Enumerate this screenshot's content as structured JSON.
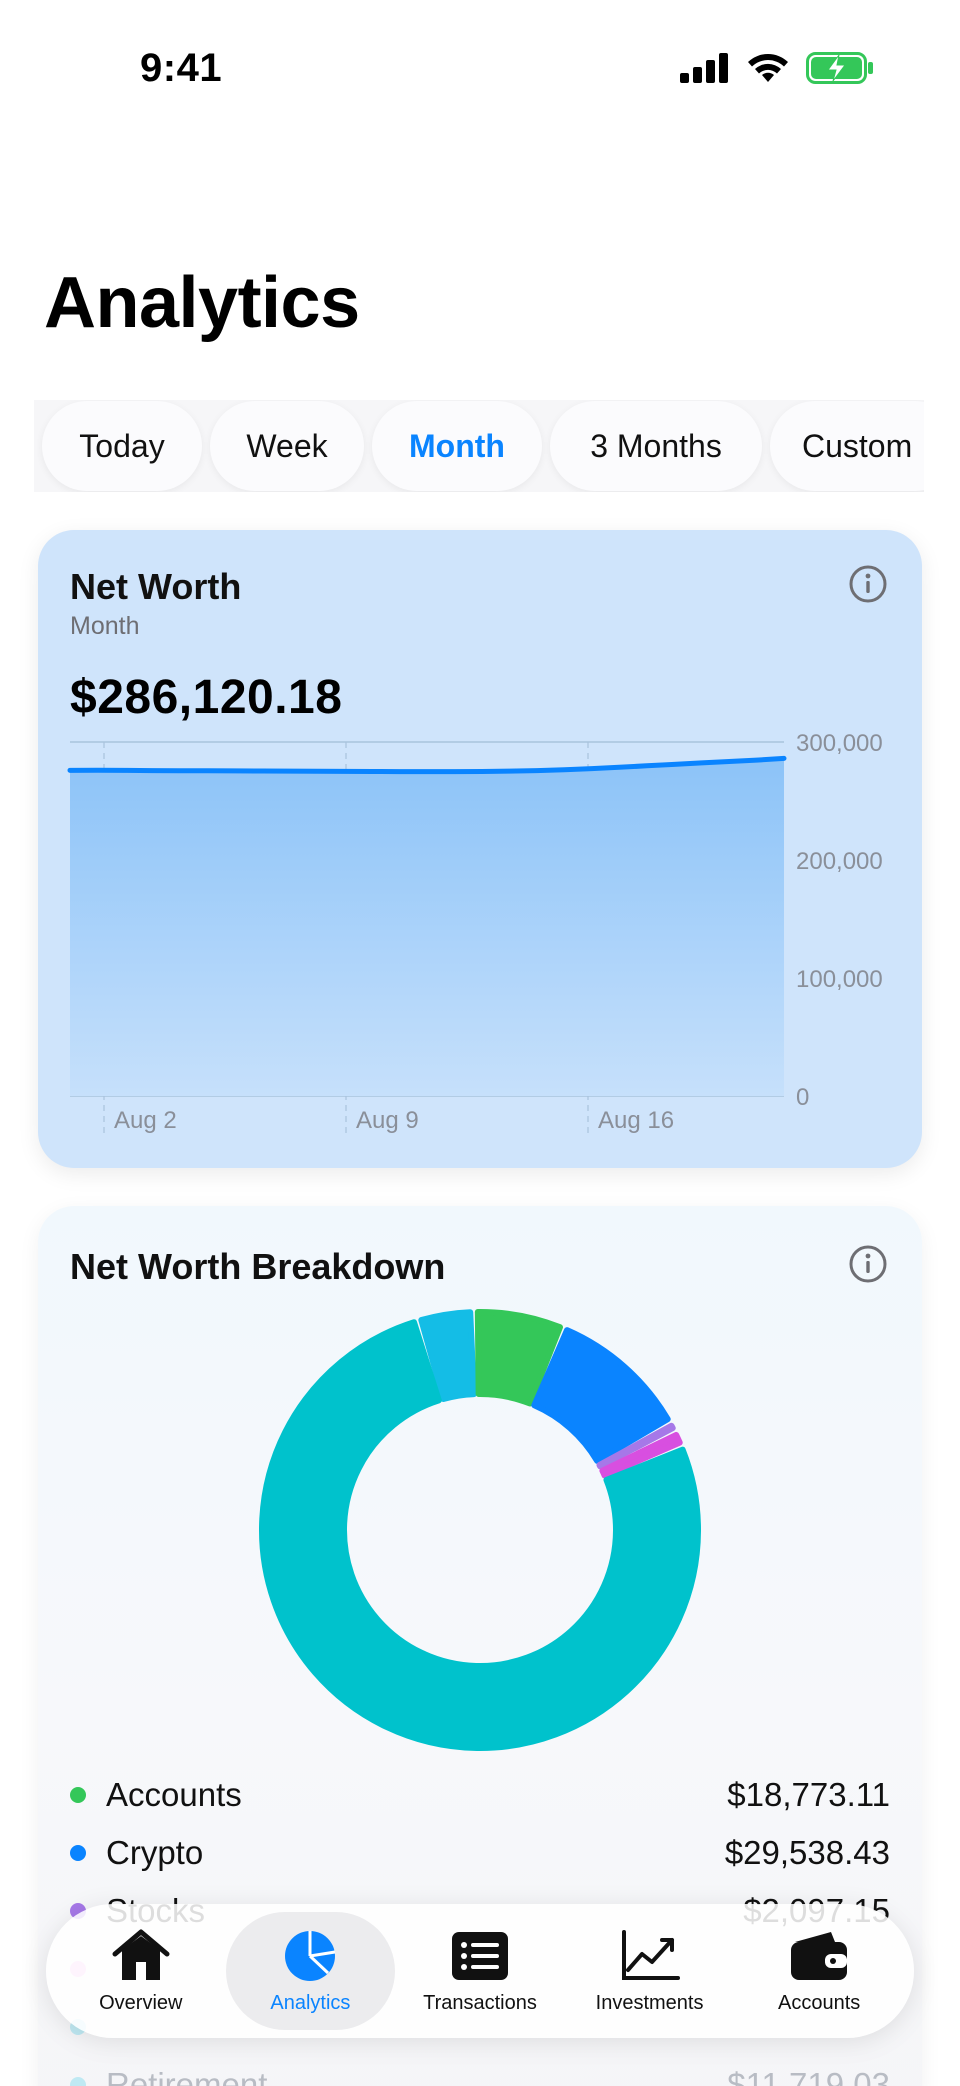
{
  "status_bar": {
    "time": "9:41"
  },
  "page": {
    "title": "Analytics"
  },
  "range_tabs": [
    {
      "label": "Today",
      "active": false
    },
    {
      "label": "Week",
      "active": false
    },
    {
      "label": "Month",
      "active": true
    },
    {
      "label": "3 Months",
      "active": false
    },
    {
      "label": "Custom",
      "active": false
    }
  ],
  "net_worth_card": {
    "title": "Net Worth",
    "subtitle": "Month",
    "value": "$286,120.18",
    "chart_data": {
      "type": "area",
      "x_ticks": [
        "Aug 2",
        "Aug 9",
        "Aug 16"
      ],
      "y_ticks": [
        "300,000",
        "200,000",
        "100,000",
        "0"
      ],
      "ylim": [
        0,
        300000
      ],
      "grid": true,
      "series": [
        {
          "values": [
            276000,
            276000,
            275900,
            275800,
            275700,
            275600,
            275500,
            275400,
            275300,
            275200,
            275100,
            275000,
            274900,
            274900,
            274900,
            275000,
            275300,
            275800,
            276500,
            277500,
            278600,
            279800,
            281000,
            282300,
            283500,
            284700,
            286120
          ]
        }
      ],
      "color": "#0a84ff"
    }
  },
  "breakdown_card": {
    "title": "Net Worth Breakdown",
    "chart_data": {
      "type": "pie",
      "style": "donut",
      "slices": [
        {
          "label": "Accounts",
          "value": 18773.11,
          "color": "#34c759"
        },
        {
          "label": "Crypto",
          "value": 29538.43,
          "color": "#0a84ff"
        },
        {
          "label": "Stocks",
          "value": 2097.15,
          "color": "#a678e8"
        },
        {
          "label": "",
          "value": 3300,
          "color": "#d84fe0"
        },
        {
          "label": "",
          "value": 215000,
          "color": "#00c2cc"
        },
        {
          "label": "Retirement",
          "value": 11719.03,
          "color": "#14bde6"
        }
      ]
    },
    "legend": [
      {
        "label": "Accounts",
        "amount": "$18,773.11",
        "color": "#34c759"
      },
      {
        "label": "Crypto",
        "amount": "$29,538.43",
        "color": "#0a84ff"
      },
      {
        "label": "Stocks",
        "amount": "$2,097.15",
        "color": "#a678e8"
      },
      {
        "label": "",
        "amount": "",
        "color": "#f4b0f0"
      },
      {
        "label": "",
        "amount": "",
        "color": "#00c2cc"
      },
      {
        "label": "Retirement",
        "amount": "$11,719.03",
        "color": "#bfe9f3"
      }
    ]
  },
  "tab_bar": [
    {
      "label": "Overview",
      "icon": "house-icon",
      "active": false
    },
    {
      "label": "Analytics",
      "icon": "pie-chart-icon",
      "active": true
    },
    {
      "label": "Transactions",
      "icon": "list-icon",
      "active": false
    },
    {
      "label": "Investments",
      "icon": "trend-icon",
      "active": false
    },
    {
      "label": "Accounts",
      "icon": "wallet-icon",
      "active": false
    }
  ]
}
